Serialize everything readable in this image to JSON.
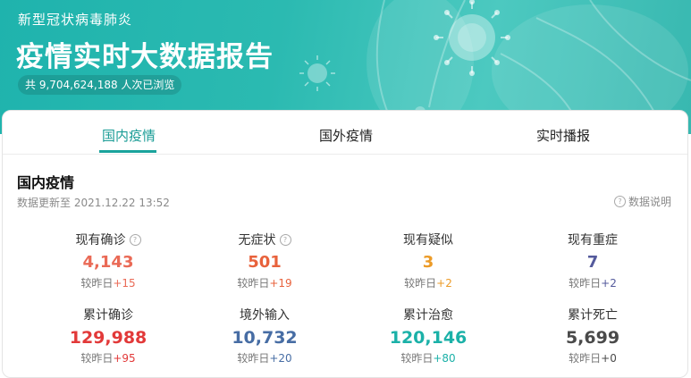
{
  "banner": {
    "subtitle": "新型冠状病毒肺炎",
    "title": "疫情实时大数据报告",
    "views": "共 9,704,624,188 人次已浏览"
  },
  "tabs": [
    {
      "label": "国内疫情",
      "active": true
    },
    {
      "label": "国外疫情",
      "active": false
    },
    {
      "label": "实时播报",
      "active": false
    }
  ],
  "section": {
    "title": "国内疫情",
    "updated": "数据更新至 2021.12.22 13:52",
    "explain": "数据说明",
    "help_icon": "?"
  },
  "stats_row1": [
    {
      "label": "现有确诊",
      "value": "4,143",
      "delta_label": "较昨日",
      "delta": "+15",
      "color": "#ea6a56",
      "help": true
    },
    {
      "label": "无症状",
      "value": "501",
      "delta_label": "较昨日",
      "delta": "+19",
      "color": "#e8623c",
      "help": true
    },
    {
      "label": "现有疑似",
      "value": "3",
      "delta_label": "较昨日",
      "delta": "+2",
      "color": "#ec9b27",
      "help": false
    },
    {
      "label": "现有重症",
      "value": "7",
      "delta_label": "较昨日",
      "delta": "+2",
      "color": "#545a9c",
      "help": false
    }
  ],
  "stats_row2": [
    {
      "label": "累计确诊",
      "value": "129,988",
      "delta_label": "较昨日",
      "delta": "+95",
      "color": "#e23939"
    },
    {
      "label": "境外输入",
      "value": "10,732",
      "delta_label": "较昨日",
      "delta": "+20",
      "color": "#476da4"
    },
    {
      "label": "累计治愈",
      "value": "120,146",
      "delta_label": "较昨日",
      "delta": "+80",
      "color": "#1bb1a8"
    },
    {
      "label": "累计死亡",
      "value": "5,699",
      "delta_label": "较昨日",
      "delta": "+0",
      "color": "#4a4a4a"
    }
  ],
  "colors": {
    "accent": "#1aa39c",
    "banner": "#2bbab1",
    "delta_red": "#e8623c",
    "delta_blue": "#476da4",
    "delta_teal": "#1bb1a8"
  }
}
